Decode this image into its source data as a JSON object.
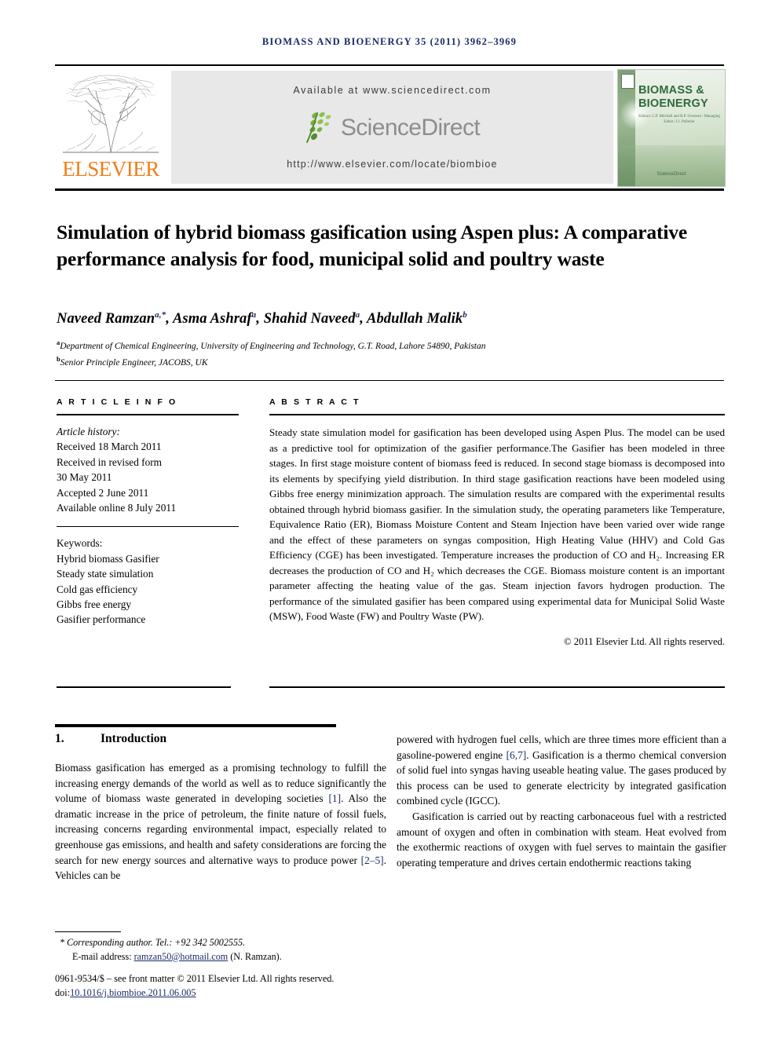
{
  "running_head": "BIOMASS AND BIOENERGY 35 (2011) 3962–3969",
  "masthead": {
    "publisher_name": "ELSEVIER",
    "publisher_logo": "elsevier-tree-logo",
    "available_at": "Available at www.sciencedirect.com",
    "sciencedirect_wordmark": "ScienceDirect",
    "journal_url": "http://www.elsevier.com/locate/biombioe",
    "cover": {
      "title_line1": "BIOMASS &",
      "title_line2": "BIOENERGY",
      "editors": "Editors: C.P. Mitchell and R.P. Overend / Managing Editor: J.J. Pelletier",
      "footer_logo": "ScienceDirect"
    }
  },
  "article": {
    "title": "Simulation of hybrid biomass gasification using Aspen plus: A comparative performance analysis for food, municipal solid and poultry waste",
    "authors": [
      {
        "name": "Naveed Ramzan",
        "marks": "a,*"
      },
      {
        "name": "Asma Ashraf",
        "marks": "a"
      },
      {
        "name": "Shahid Naveed",
        "marks": "a"
      },
      {
        "name": "Abdullah Malik",
        "marks": "b"
      }
    ],
    "affiliations": [
      {
        "mark": "a",
        "text": "Department of Chemical Engineering, University of Engineering and Technology, G.T. Road, Lahore 54890, Pakistan"
      },
      {
        "mark": "b",
        "text": "Senior Principle Engineer, JACOBS, UK"
      }
    ]
  },
  "article_info": {
    "label": "A R T I C L E   I N F O",
    "history_label": "Article history:",
    "history": [
      "Received 18 March 2011",
      "Received in revised form",
      "30 May 2011",
      "Accepted 2 June 2011",
      "Available online 8 July 2011"
    ],
    "keywords_label": "Keywords:",
    "keywords": [
      "Hybrid biomass Gasifier",
      "Steady state simulation",
      "Cold gas efficiency",
      "Gibbs free energy",
      "Gasifier performance"
    ]
  },
  "abstract": {
    "label": "A B S T R A C T",
    "text": "Steady state simulation model for gasification has been developed using Aspen Plus. The model can be used as a predictive tool for optimization of the gasifier performance.The Gasifier has been modeled in three stages. In first stage moisture content of biomass feed is reduced. In second stage biomass is decomposed into its elements by specifying yield distribution. In third stage gasification reactions have been modeled using Gibbs free energy minimization approach. The simulation results are compared with the experimental results obtained through hybrid biomass gasifier. In the simulation study, the operating parameters like Temperature, Equivalence Ratio (ER), Biomass Moisture Content and Steam Injection have been varied over wide range and the effect of these parameters on syngas composition, High Heating Value (HHV) and Cold Gas Efficiency (CGE) has been investigated. Temperature increases the production of CO and H₂. Increasing ER decreases the production of CO and H₂ which decreases the CGE. Biomass moisture content is an important parameter affecting the heating value of the gas. Steam injection favors hydrogen production. The performance of the simulated gasifier has been compared using experimental data for Municipal Solid Waste (MSW), Food Waste (FW) and Poultry Waste (PW).",
    "copyright": "© 2011 Elsevier Ltd. All rights reserved."
  },
  "body": {
    "section_number": "1.",
    "section_title": "Introduction",
    "left_paragraph": "Biomass gasification has emerged as a promising technology to fulfill the increasing energy demands of the world as well as to reduce significantly the volume of biomass waste generated in developing societies [1]. Also the dramatic increase in the price of petroleum, the finite nature of fossil fuels, increasing concerns regarding environmental impact, especially related to greenhouse gas emissions, and health and safety considerations are forcing the search for new energy sources and alternative ways to produce power [2–5]. Vehicles can be",
    "right_paragraph_1": "powered with hydrogen fuel cells, which are three times more efficient than a gasoline-powered engine [6,7]. Gasification is a thermo chemical conversion of solid fuel into syngas having useable heating value. The gases produced by this process can be used to generate electricity by integrated gasification combined cycle (IGCC).",
    "right_paragraph_2": "Gasification is carried out by reacting carbonaceous fuel with a restricted amount of oxygen and often in combination with steam. Heat evolved from the exothermic reactions of oxygen with fuel serves to maintain the gasifier operating temperature and drives certain endothermic reactions taking",
    "citations": [
      "[1]",
      "[2–5]",
      "[6,7]"
    ]
  },
  "footer": {
    "corresponding_author": "* Corresponding author. Tel.: +92 342 5002555.",
    "email_label": "E-mail address:",
    "email": "ramzan50@hotmail.com",
    "email_suffix": "(N. Ramzan).",
    "issn_line": "0961-9534/$ – see front matter © 2011 Elsevier Ltd. All rights reserved.",
    "doi_label": "doi:",
    "doi": "10.1016/j.biombioe.2011.06.005"
  }
}
